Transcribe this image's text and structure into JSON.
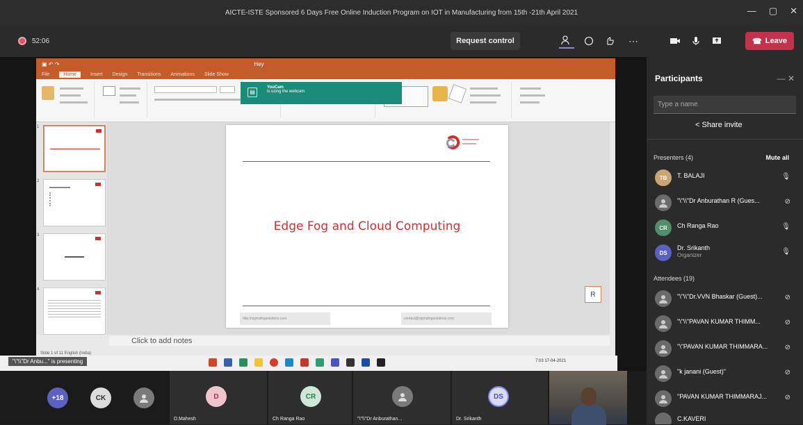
{
  "window": {
    "title": "AICTE-ISTE Sponsored 6 Days Free Online Induction Program on IOT in Manufacturing from 15th -21th April 2021",
    "controls": [
      "—",
      "▢",
      "✕"
    ]
  },
  "meeting_bar": {
    "timer": "52:06",
    "request_control": "Request control",
    "leave": "Leave"
  },
  "ppt": {
    "title": "Hey",
    "tabs": [
      "File",
      "Home",
      "Insert",
      "Design",
      "Transitions",
      "Animations",
      "Slide Show"
    ],
    "toast_title": "YouCam",
    "toast_text": "is using the webcam",
    "slide_title": "Edge Fog and Cloud Computing",
    "footer_left": "http://sigmafogsolutions.com",
    "footer_right": "contact@sigmafogsolutions.com",
    "notes": "Click to add notes",
    "status": "Slide 1 of 11   English (India)",
    "share_badge": "R",
    "taskbar_name": "\"\\\"\\\\\"Dr Anbu...\" is presenting",
    "clock": "7:03 17-04-2021"
  },
  "panel": {
    "title": "Participants",
    "search_placeholder": "Type a name",
    "share_invite": "Share invite",
    "presenters_label": "Presenters (4)",
    "mute_all": "Mute all",
    "attendees_label": "Attendees (19)",
    "presenters": [
      {
        "initials": "TB",
        "name": "T. BALAJI",
        "sub": "",
        "color": "#c9a574"
      },
      {
        "initials": "",
        "name": "\"\\\"\\\\\"Dr Anburathan R (Gues...",
        "sub": "",
        "color": "#6b6b6b"
      },
      {
        "initials": "CR",
        "name": "Ch Ranga Rao",
        "sub": "",
        "color": "#4f8f6a"
      },
      {
        "initials": "DS",
        "name": "Dr. Srikanth",
        "sub": "Organizer",
        "color": "#5b61c0"
      }
    ],
    "attendees": [
      {
        "name": "\"\\\"\\\\\"Dr.VVN Bhaskar (Guest)...",
        "color": "#6b6b6b"
      },
      {
        "name": "\"\\\"\\\\\"PAVAN KUMAR THIMM...",
        "color": "#6b6b6b"
      },
      {
        "name": "\"\\\"PAVAN KUMAR THIMMARA...",
        "color": "#6b6b6b"
      },
      {
        "name": "\"k janani (Guest)\"",
        "color": "#6b6b6b"
      },
      {
        "name": "\"PAVAN KUMAR THIMMARAJ...",
        "color": "#6b6b6b"
      },
      {
        "name": "C.KAVERI",
        "color": "#6b6b6b"
      }
    ]
  },
  "gallery": {
    "tiles": [
      {
        "initials": "+18",
        "name": "",
        "color": "#5b61c0"
      },
      {
        "initials": "CK",
        "name": "",
        "color": "#dcdcdc"
      },
      {
        "initials": "",
        "name": "",
        "color": "#7a7a7a"
      },
      {
        "initials": "D",
        "name": "D.Mahesh",
        "color": "#f0c4cc"
      },
      {
        "initials": "CR",
        "name": "Ch Ranga Rao",
        "color": "#cfe7d6"
      },
      {
        "initials": "",
        "name": "\"\\\"\\\\\"Dr Anburathan...",
        "color": "#7a7a7a"
      },
      {
        "initials": "DS",
        "name": "Dr. Srikanth",
        "color": "#d9dbf4"
      }
    ]
  }
}
